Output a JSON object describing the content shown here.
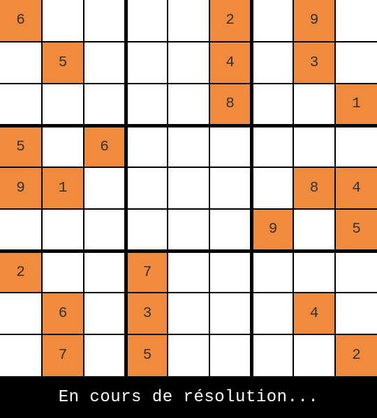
{
  "board": {
    "size": 9,
    "cells": [
      [
        "6",
        "",
        "",
        "",
        "",
        "2",
        "",
        "9",
        ""
      ],
      [
        "",
        "5",
        "",
        "",
        "",
        "4",
        "",
        "3",
        ""
      ],
      [
        "",
        "",
        "",
        "",
        "",
        "8",
        "",
        "",
        "1"
      ],
      [
        "5",
        "",
        "6",
        "",
        "",
        "",
        "",
        "",
        ""
      ],
      [
        "9",
        "1",
        "",
        "",
        "",
        "",
        "",
        "8",
        "4"
      ],
      [
        "",
        "",
        "",
        "",
        "",
        "",
        "9",
        "",
        "5"
      ],
      [
        "2",
        "",
        "",
        "7",
        "",
        "",
        "",
        "",
        ""
      ],
      [
        "",
        "6",
        "",
        "3",
        "",
        "",
        "",
        "4",
        ""
      ],
      [
        "",
        "7",
        "",
        "5",
        "",
        "",
        "",
        "",
        "2"
      ]
    ],
    "colors": {
      "given_cell": "#f08a3c",
      "empty_cell": "#ffffff",
      "grid_lines": "#000000",
      "digit": "#333333"
    }
  },
  "status": {
    "text": "En cours de résolution..."
  }
}
